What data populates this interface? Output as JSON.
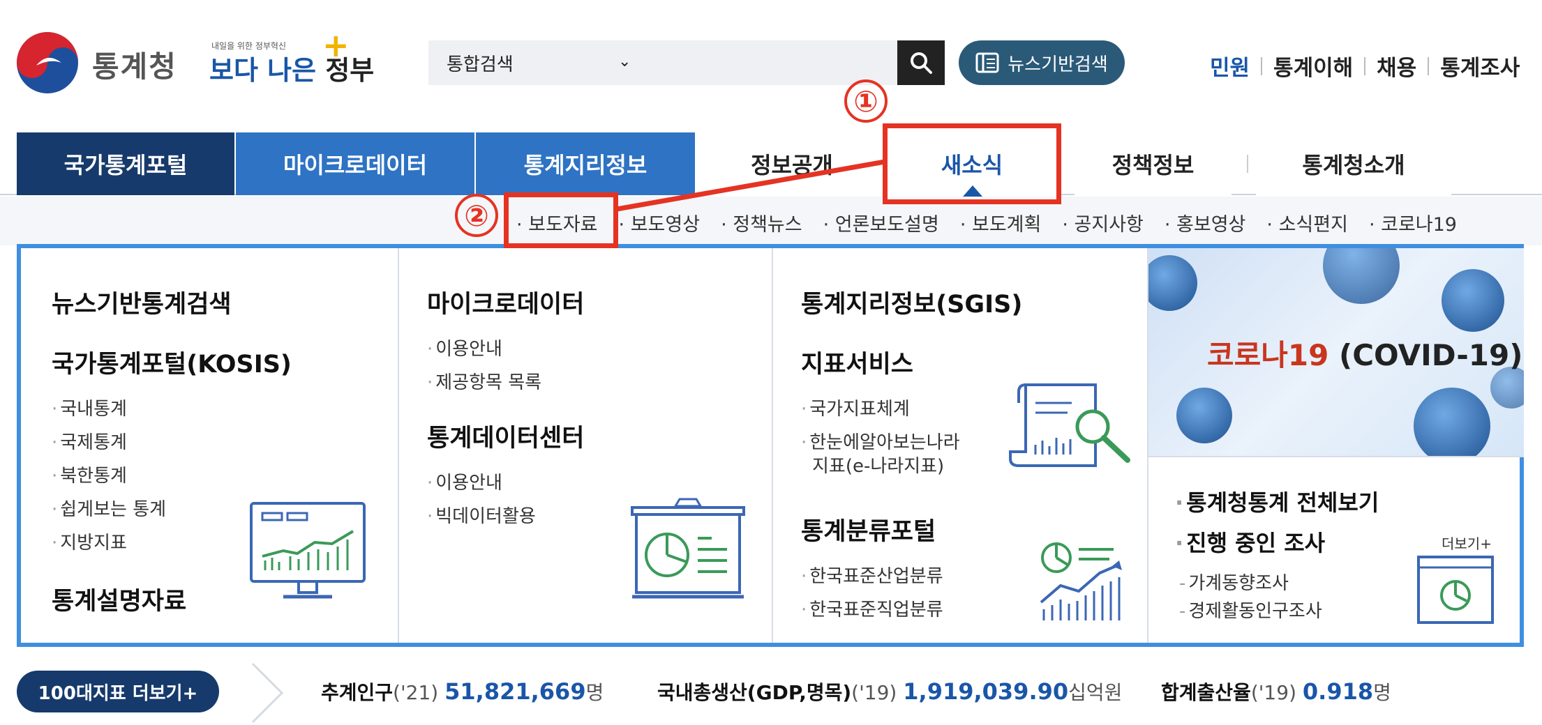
{
  "header": {
    "logo_text": "통계청",
    "slogan_small": "내일을 위한 정부혁신",
    "slogan_big": "보다 나은 정부",
    "search_scope": "통합검색",
    "news_search_label": "뉴스기반검색",
    "util_links": [
      "민원",
      "통계이해",
      "채용",
      "통계조사"
    ]
  },
  "nav": {
    "items": [
      "국가통계포털",
      "마이크로데이터",
      "통계지리정보",
      "정보공개",
      "새소식",
      "정책정보",
      "통계청소개"
    ]
  },
  "subnav": {
    "items": [
      "· 보도자료",
      "· 보도영상",
      "· 정책뉴스",
      "· 언론보도설명",
      "· 보도계획",
      "· 공지사항",
      "· 홍보영상",
      "· 소식편지",
      "· 코로나19"
    ]
  },
  "annotations": {
    "num1": "①",
    "num2": "②"
  },
  "panel": {
    "col1": {
      "h1": "뉴스기반통계검색",
      "h2": "국가통계포털(KOSIS)",
      "items": [
        "국내통계",
        "국제통계",
        "북한통계",
        "쉽게보는 통계",
        "지방지표"
      ],
      "h3": "통계설명자료"
    },
    "col2": {
      "h1": "마이크로데이터",
      "items1": [
        "이용안내",
        "제공항목 목록"
      ],
      "h2": "통계데이터센터",
      "items2": [
        "이용안내",
        "빅데이터활용"
      ]
    },
    "col3": {
      "h1": "통계지리정보(SGIS)",
      "h2": "지표서비스",
      "items1": [
        "국가지표체계",
        "한눈에알아보는나라"
      ],
      "items1_cont": "지표(e-나라지표)",
      "h3": "통계분류포털",
      "items2": [
        "한국표준산업분류",
        "한국표준직업분류"
      ]
    },
    "col4": {
      "covid_red": "코로나19",
      "covid_rest": " (COVID-19)",
      "h1": "통계청통계 전체보기",
      "h2": "진행 중인 조사",
      "more": "더보기+",
      "items": [
        "가계동향조사",
        "경제활동인구조사"
      ]
    }
  },
  "bottom": {
    "more_btn": "100대지표 더보기+",
    "stats": [
      {
        "label": "추계인구",
        "year": "('21)",
        "value": "51,821,669",
        "unit": "명"
      },
      {
        "label": "국내총생산(GDP,명목)",
        "year": "('19)",
        "value": "1,919,039.90",
        "unit": "십억원"
      },
      {
        "label": "합계출산율",
        "year": "('19)",
        "value": "0.918",
        "unit": "명"
      }
    ]
  }
}
